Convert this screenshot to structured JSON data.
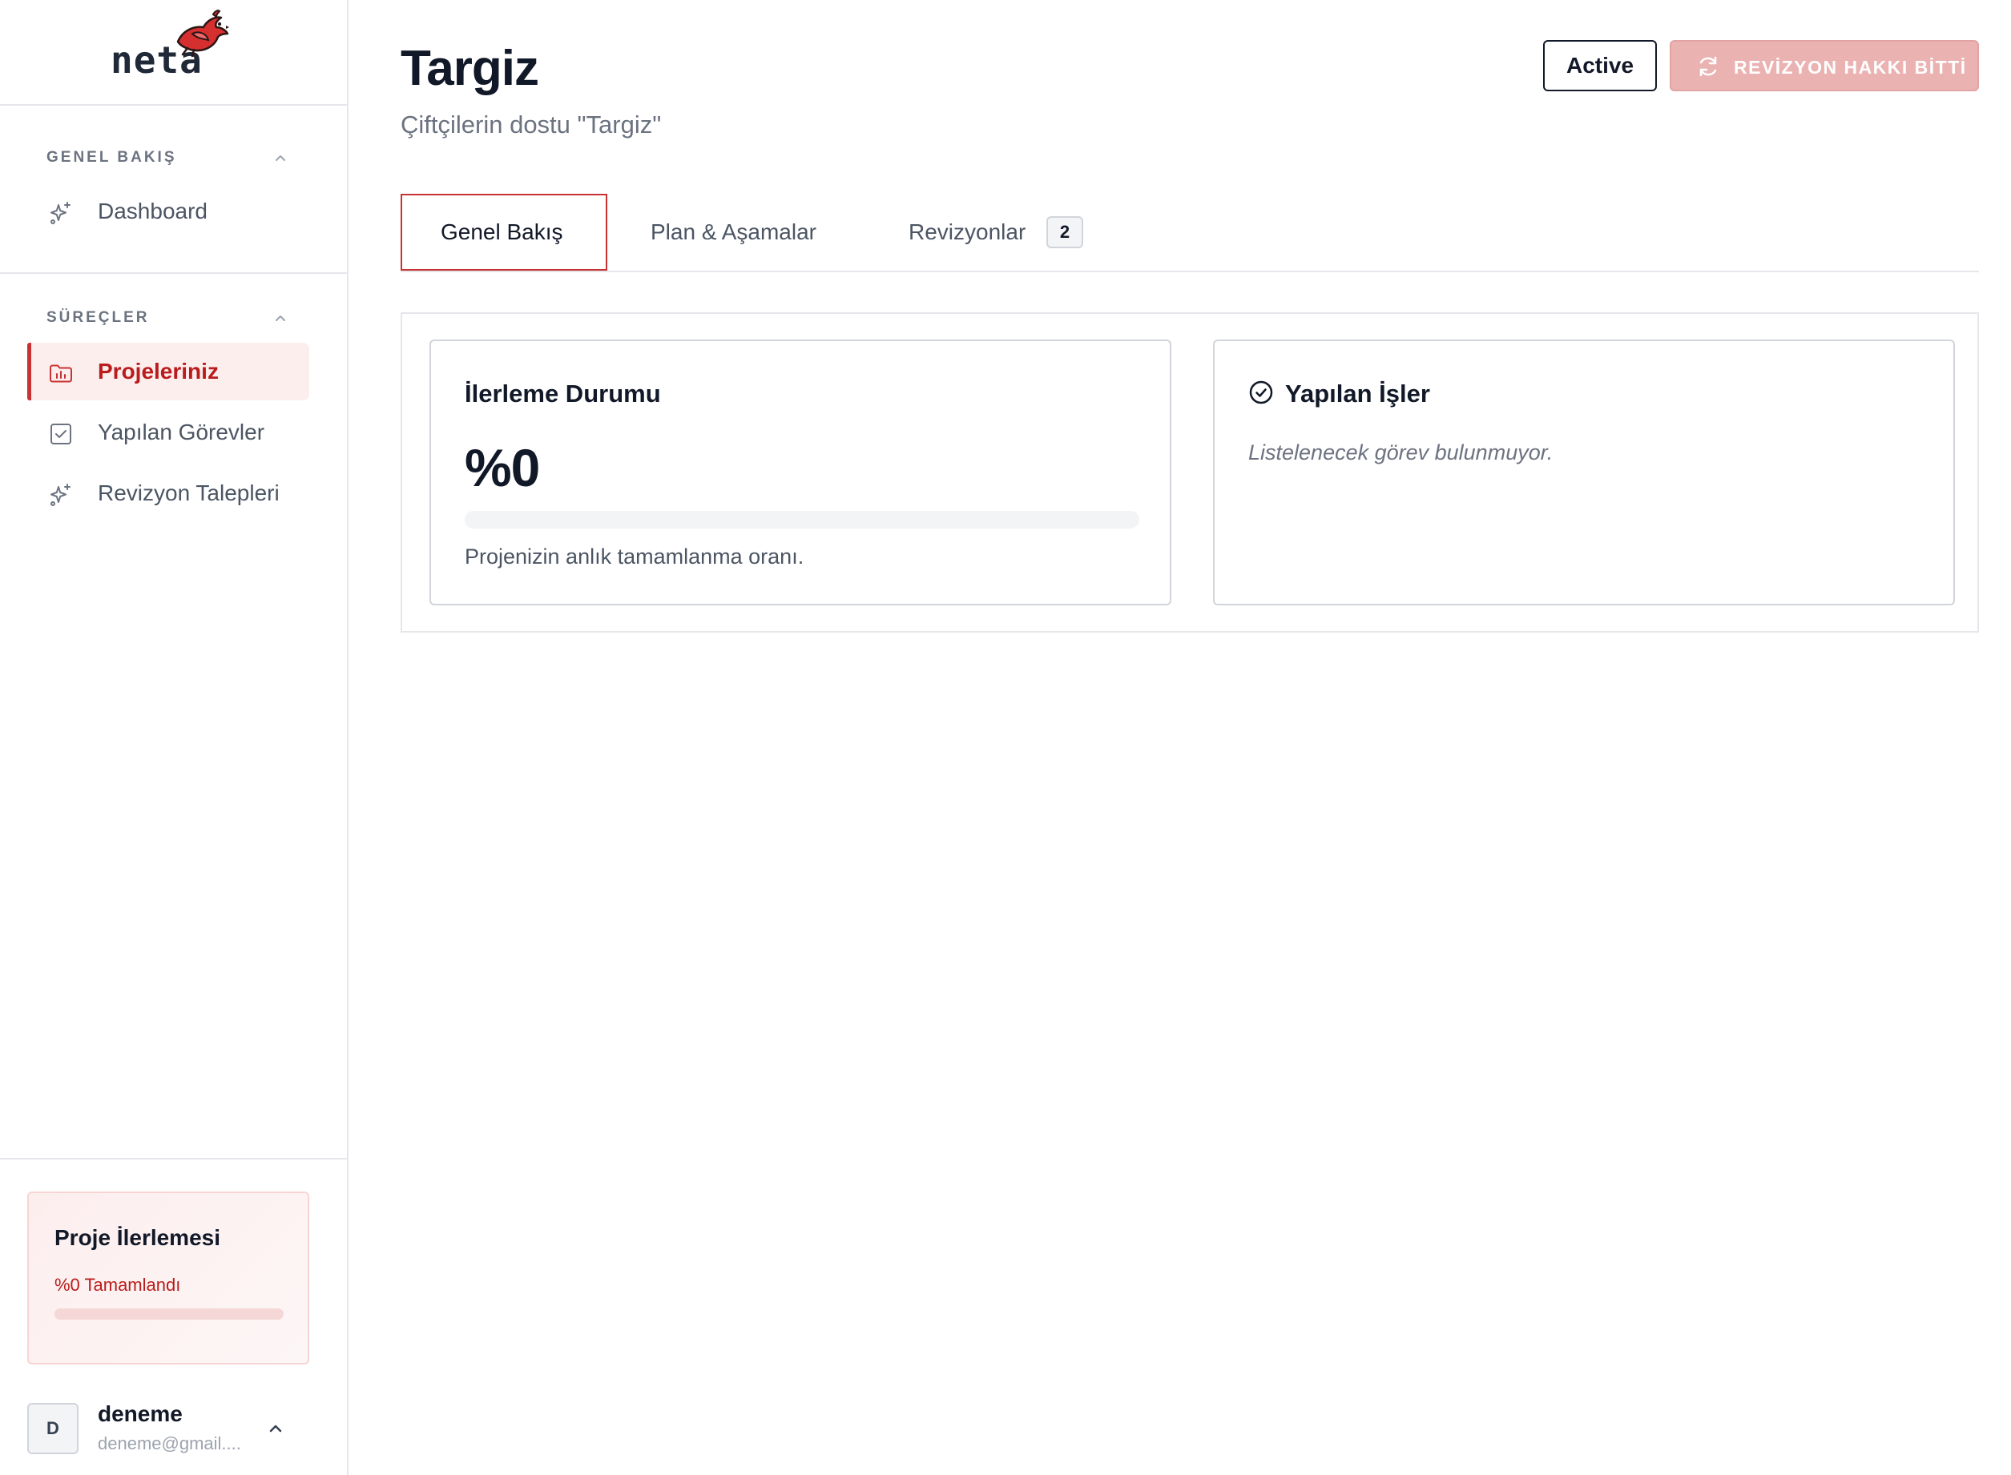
{
  "app": {
    "logo_text": "neta"
  },
  "colors": {
    "accent": "#c93232",
    "accent_soft": "#fdeeee",
    "disabled_button": "#ebb2b2"
  },
  "sidebar": {
    "sections": [
      {
        "heading": "GENEL BAKIŞ",
        "items": [
          {
            "label": "Dashboard",
            "icon": "sparkles-icon",
            "active": false
          }
        ]
      },
      {
        "heading": "SÜREÇLER",
        "items": [
          {
            "label": "Projeleriniz",
            "icon": "folder-chart-icon",
            "active": true
          },
          {
            "label": "Yapılan Görevler",
            "icon": "checkbox-icon",
            "active": false
          },
          {
            "label": "Revizyon Talepleri",
            "icon": "sparkles-icon",
            "active": false
          }
        ]
      }
    ],
    "progress_card": {
      "title": "Proje İlerlemesi",
      "status": "%0 Tamamlandı",
      "progress": 0
    },
    "user": {
      "initial": "D",
      "name": "deneme",
      "email": "deneme@gmail...."
    }
  },
  "header": {
    "title": "Targiz",
    "subtitle": "Çiftçilerin dostu \"Targiz\"",
    "status_label": "Active",
    "revision_button_label": "REVİZYON HAKKI BİTTİ"
  },
  "tabs": [
    {
      "label": "Genel Bakış",
      "active": true
    },
    {
      "label": "Plan & Aşamalar",
      "active": false
    },
    {
      "label": "Revizyonlar",
      "active": false,
      "badge": "2"
    }
  ],
  "overview": {
    "progress_card": {
      "title": "İlerleme Durumu",
      "value": "%0",
      "progress": 0,
      "note": "Projenizin anlık tamamlanma oranı."
    },
    "tasks_card": {
      "title": "Yapılan İşler",
      "empty_text": "Listelenecek görev bulunmuyor."
    }
  }
}
